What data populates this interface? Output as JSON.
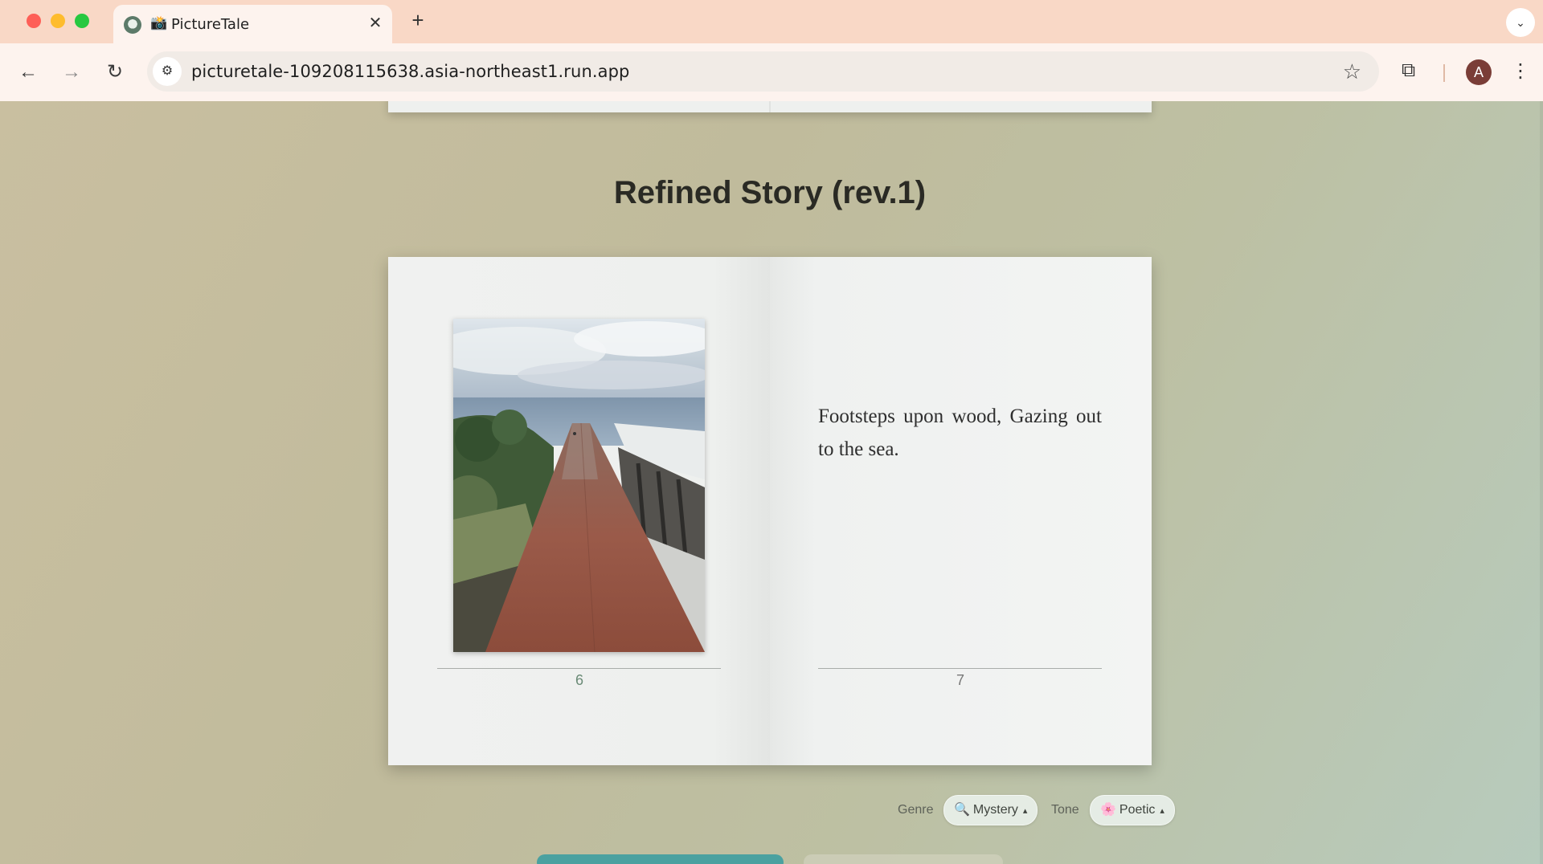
{
  "browser": {
    "tab": {
      "emoji": "📸",
      "title": "PictureTale"
    },
    "url": "picturetale-109208115638.asia-northeast1.run.app",
    "avatar_letter": "A"
  },
  "story": {
    "heading": "Refined Story (rev.1)",
    "left_page": {
      "image_alt": "Rusty walkway stretching toward the sea under a cloudy sky",
      "page_number": "6"
    },
    "right_page": {
      "text": "Footsteps upon wood, Gazing out to the sea.",
      "page_number": "7"
    }
  },
  "controls": {
    "genre_label": "Genre",
    "genre_icon": "🔍",
    "genre_value": "Mystery",
    "tone_label": "Tone",
    "tone_icon": "🌸",
    "tone_value": "Poetic",
    "caret": "▴"
  }
}
